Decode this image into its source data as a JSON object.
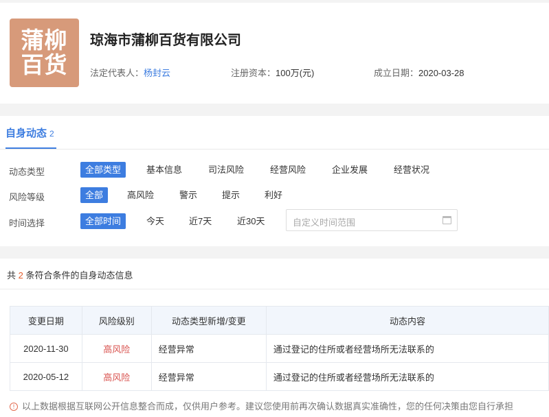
{
  "company": {
    "logo_line1": "蒲柳",
    "logo_line2": "百货",
    "name": "琼海市蒲柳百货有限公司",
    "legal_rep_label": "法定代表人：",
    "legal_rep": "杨封云",
    "capital_label": "注册资本：",
    "capital": "100万(元)",
    "founded_label": "成立日期：",
    "founded": "2020-03-28"
  },
  "tab": {
    "label": "自身动态",
    "count": "2"
  },
  "filters": {
    "type": {
      "label": "动态类型",
      "options": [
        "全部类型",
        "基本信息",
        "司法风险",
        "经营风险",
        "企业发展",
        "经营状况"
      ]
    },
    "risk": {
      "label": "风险等级",
      "options": [
        "全部",
        "高风险",
        "警示",
        "提示",
        "利好"
      ]
    },
    "time": {
      "label": "时间选择",
      "options": [
        "全部时间",
        "今天",
        "近7天",
        "近30天"
      ],
      "range_placeholder": "自定义时间范围"
    }
  },
  "result": {
    "prefix": "共",
    "count": "2",
    "suffix": "条符合条件的自身动态信息"
  },
  "table": {
    "headers": [
      "变更日期",
      "风险级别",
      "动态类型新增/变更",
      "动态内容"
    ],
    "rows": [
      {
        "date": "2020-11-30",
        "risk": "高风险",
        "type": "经营异常",
        "content": "通过登记的住所或者经营场所无法联系的"
      },
      {
        "date": "2020-05-12",
        "risk": "高风险",
        "type": "经营异常",
        "content": "通过登记的住所或者经营场所无法联系的"
      }
    ]
  },
  "footnote": "以上数据根据互联网公开信息整合而成，仅供用户参考。建议您使用前再次确认数据真实准确性，您的任何决策由您自行承担",
  "colors": {
    "accent": "#3d7de0",
    "danger": "#d9534f",
    "logo_bg": "#d79a7a"
  }
}
